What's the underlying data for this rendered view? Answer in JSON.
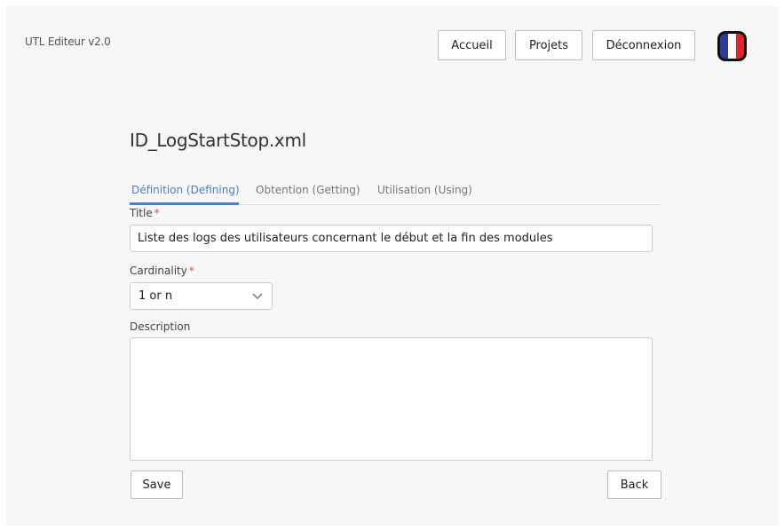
{
  "header": {
    "brand": "UTL Editeur v2.0",
    "nav": {
      "home": "Accueil",
      "projects": "Projets",
      "logout": "Déconnexion"
    },
    "language_flag": "flag-fr-icon"
  },
  "page": {
    "file_title": "ID_LogStartStop.xml",
    "tabs": [
      {
        "label": "Définition (Defining)",
        "active": true
      },
      {
        "label": "Obtention (Getting)",
        "active": false
      },
      {
        "label": "Utilisation (Using)",
        "active": false
      }
    ]
  },
  "form": {
    "title_label": "Title",
    "title_value": "Liste des logs des utilisateurs concernant le début et la fin des modules",
    "cardinality_label": "Cardinality",
    "cardinality_value": "1 or n",
    "description_label": "Description",
    "description_value": "",
    "required_marker": "*"
  },
  "actions": {
    "save": "Save",
    "back": "Back"
  },
  "colors": {
    "accent": "#4a7fc1",
    "required": "#d9534f",
    "background": "#f7f7f7"
  }
}
